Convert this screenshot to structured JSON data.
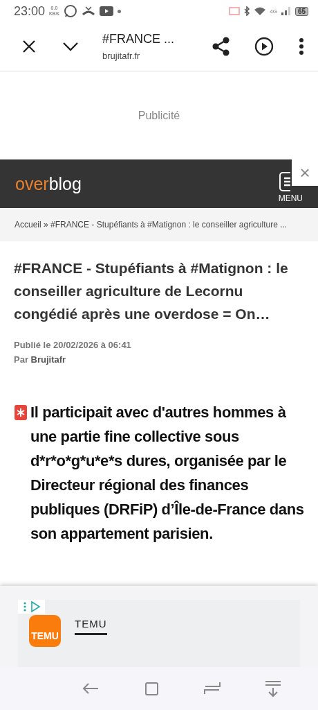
{
  "status_bar": {
    "time": "23:00",
    "speed_value": "0.0",
    "speed_unit": "KB/s",
    "battery": "65",
    "network": "4G"
  },
  "toolbar": {
    "title": "#FRANCE ...",
    "url": "brujitafr.fr"
  },
  "ad_slot": {
    "label": "Publicité"
  },
  "site_header": {
    "logo_accent": "over",
    "logo_rest": "blog",
    "menu_label": "MENU",
    "close_label": "×"
  },
  "breadcrumb": "Accueil » #FRANCE - Stupéfiants à #Matignon : le conseiller agriculture ...",
  "article": {
    "title": "#FRANCE - Stupéfiants à #Matignon : le conseiller agriculture de Lecornu congédié après une overdose = On…",
    "published": "Publié le 20/02/2026 à 06:41",
    "author_prefix": "Par",
    "author": "Brujitafr",
    "body": "Il participait avec d'autres hommes à une partie fine collective sous d*r*o*g*u*e*s dures, organisée par le Directeur régional des finances publiques (DRFiP) d’Île-de-France dans son appartement parisien."
  },
  "bottom_ad": {
    "logo_text": "TEMU",
    "brand": "TEMU"
  }
}
